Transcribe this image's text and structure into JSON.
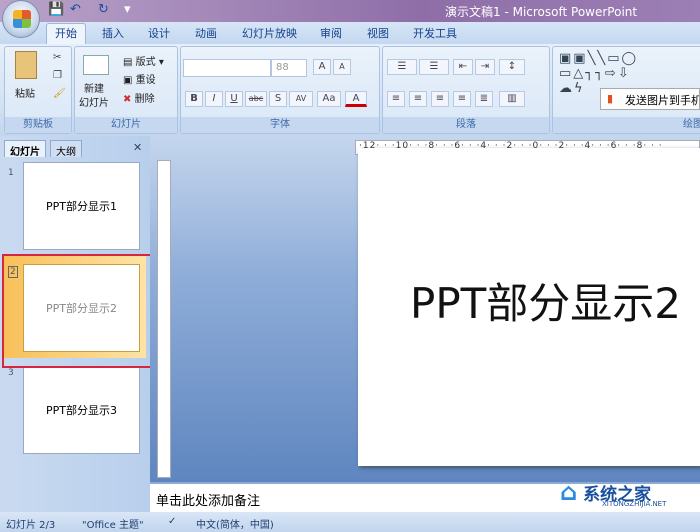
{
  "window": {
    "title": "演示文稿1 - Microsoft PowerPoint"
  },
  "quick_access": {
    "save": "💾",
    "undo": "↶",
    "redo": "↻",
    "more": "▾"
  },
  "tabs": [
    "开始",
    "插入",
    "设计",
    "动画",
    "幻灯片放映",
    "审阅",
    "视图",
    "开发工具"
  ],
  "ribbon": {
    "clipboard": {
      "label": "剪贴板",
      "paste": "粘贴"
    },
    "slides": {
      "label": "幻灯片",
      "new_slide": "新建\n幻灯片",
      "layout": "版式",
      "reset": "重设",
      "delete": "删除"
    },
    "font": {
      "label": "字体",
      "font_name": "",
      "font_size": "88",
      "bold": "B",
      "italic": "I",
      "underline": "U",
      "strike": "abc",
      "shadow": "S",
      "spacing": "AV",
      "case": "Aa",
      "grow": "A",
      "shrink": "A",
      "color": "A"
    },
    "paragraph": {
      "label": "段落"
    },
    "drawing": {
      "label": "绘图",
      "tooltip": "发送图片到手机"
    }
  },
  "left_panel": {
    "tabs": [
      "幻灯片",
      "大纲"
    ],
    "close": "✕",
    "slides": [
      {
        "num": "1",
        "title": "PPT部分显示1"
      },
      {
        "num": "2",
        "title": "PPT部分显示2"
      },
      {
        "num": "3",
        "title": "PPT部分显示3"
      }
    ]
  },
  "ruler": "·12· · ·10· · ·8· · ·6· · ·4· · ·2· · ·0· · ·2· · ·4· · ·6· · ·8· · ·",
  "slide": {
    "title": "PPT部分显示2"
  },
  "notes": {
    "placeholder": "单击此处添加备注"
  },
  "status": {
    "slide": "幻灯片 2/3",
    "theme": "\"Office 主题\"",
    "language": "中文(简体，中国)"
  },
  "watermark": {
    "name": "系统之家",
    "url": "XITONGZHIJIA.NET"
  },
  "colors": {
    "highlight": "#d7263d",
    "selected": "#f8c05a"
  }
}
